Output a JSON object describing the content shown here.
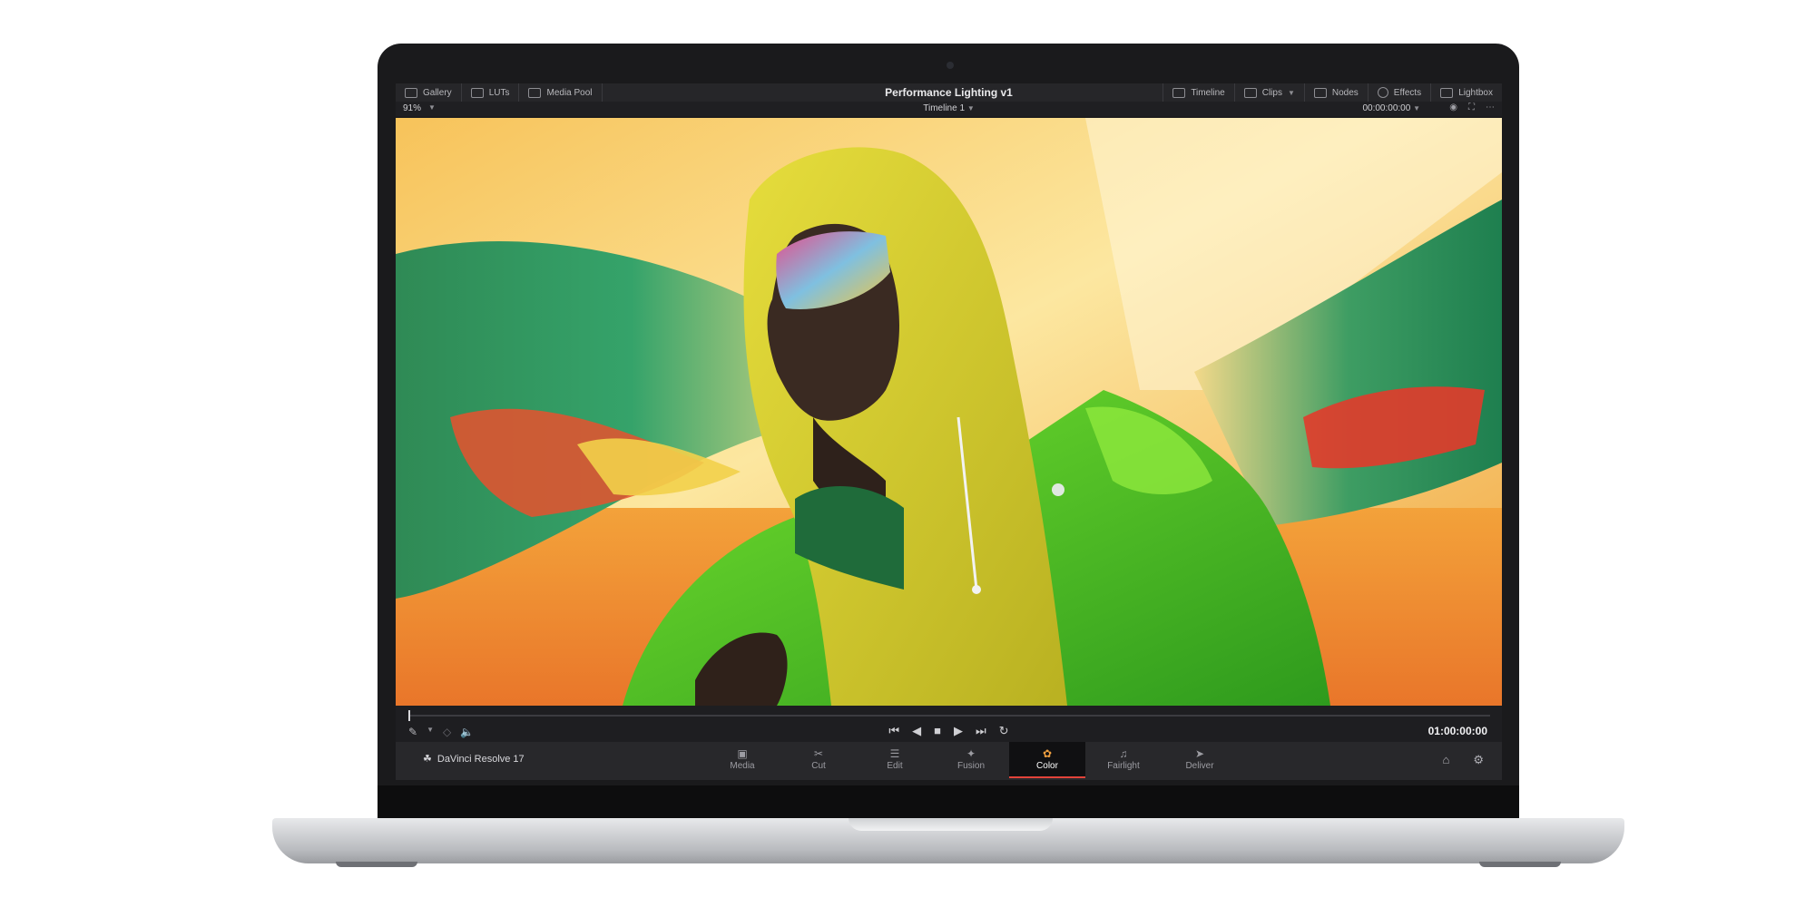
{
  "topbar": {
    "left_items": [
      {
        "label": "Gallery",
        "icon": "gallery-icon"
      },
      {
        "label": "LUTs",
        "icon": "luts-icon"
      },
      {
        "label": "Media Pool",
        "icon": "media-pool-icon"
      }
    ],
    "title": "Performance Lighting v1",
    "right_items": [
      {
        "label": "Timeline",
        "icon": "timeline-icon"
      },
      {
        "label": "Clips",
        "icon": "clips-icon"
      },
      {
        "label": "Nodes",
        "icon": "nodes-icon"
      },
      {
        "label": "Effects",
        "icon": "effects-icon"
      },
      {
        "label": "Lightbox",
        "icon": "lightbox-icon"
      }
    ]
  },
  "viewerbar": {
    "zoom": "91%",
    "timeline_name": "Timeline 1",
    "timecode": "00:00:00:00"
  },
  "transport": {
    "timecode": "01:00:00:00",
    "controls": [
      "skip-back-icon",
      "step-back-icon",
      "stop-icon",
      "play-icon",
      "skip-forward-icon",
      "loop-icon"
    ]
  },
  "pagebar": {
    "brand": "DaVinci Resolve 17",
    "pages": [
      {
        "label": "Media",
        "icon": "media-page-icon"
      },
      {
        "label": "Cut",
        "icon": "cut-page-icon"
      },
      {
        "label": "Edit",
        "icon": "edit-page-icon"
      },
      {
        "label": "Fusion",
        "icon": "fusion-page-icon"
      },
      {
        "label": "Color",
        "icon": "color-page-icon",
        "active": true
      },
      {
        "label": "Fairlight",
        "icon": "fairlight-page-icon"
      },
      {
        "label": "Deliver",
        "icon": "deliver-page-icon"
      }
    ]
  },
  "colors": {
    "accent": "#e2433a",
    "ui_dark": "#1c1c1e"
  }
}
